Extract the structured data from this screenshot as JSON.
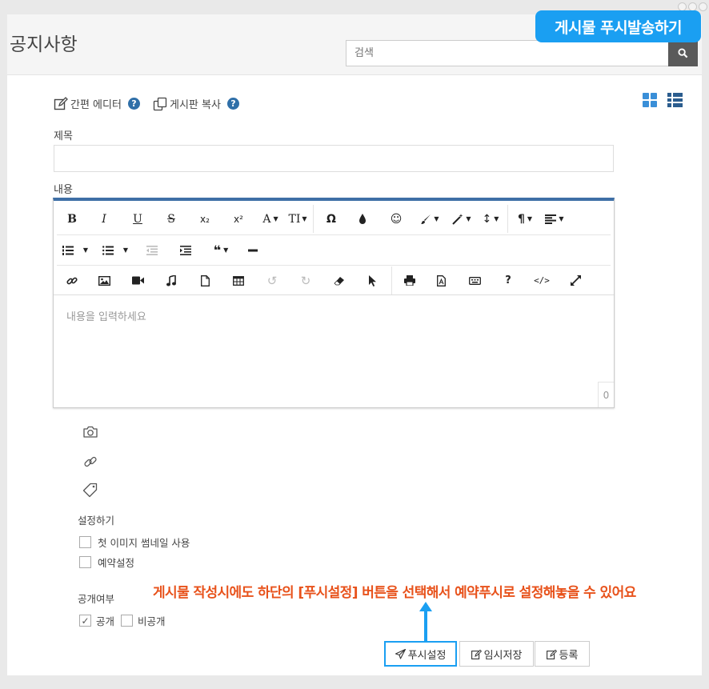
{
  "header": {
    "title": "공지사항",
    "search_placeholder": "검색"
  },
  "callout": {
    "text": "게시물 푸시발송하기",
    "color": "#1a9ff2"
  },
  "tools": {
    "simple_editor": "간편 에디터",
    "copy_board": "게시판 복사",
    "help": "?"
  },
  "form": {
    "title_label": "제목",
    "content_label": "내용",
    "content_placeholder": "내용을 입력하세요",
    "char_count": "0"
  },
  "toolbar": {
    "bold": "B",
    "italic": "I",
    "underline": "U",
    "strike": "S",
    "subscript": "x₂",
    "superscript": "x²",
    "font": "A",
    "fontsize": "TI",
    "omega": "Ω",
    "blockquote": "❝"
  },
  "settings": {
    "label": "설정하기",
    "thumbnail": "첫 이미지 썸네일 사용",
    "scheduled": "예약설정"
  },
  "visibility": {
    "label": "공개여부",
    "public": "공개",
    "private": "비공개",
    "public_checked": true,
    "private_checked": false
  },
  "annotation": {
    "text": "게시물 작성시에도 하단의 [푸시설정] 버튼을 선택해서 예약푸시로 설정해놓을 수 있어요",
    "color": "#e8521b"
  },
  "buttons": {
    "push": "푸시설정",
    "draft": "임시저장",
    "submit": "등록"
  }
}
